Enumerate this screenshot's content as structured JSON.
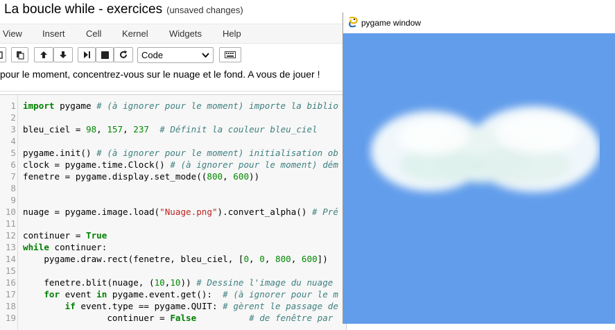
{
  "notebook": {
    "title": "La boucle while - exercices",
    "unsaved": "(unsaved changes)",
    "menu": [
      "View",
      "Insert",
      "Cell",
      "Kernel",
      "Widgets",
      "Help"
    ],
    "cell_type": "Code",
    "markdown_line": "pour le moment, concentrez-vous sur le nuage et le fond. A vous de jouer !"
  },
  "code": {
    "line_numbers": [
      "1",
      "2",
      "3",
      "4",
      "5",
      "6",
      "7",
      "8",
      "9",
      "10",
      "11",
      "12",
      "13",
      "14",
      "15",
      "16",
      "17",
      "18",
      "19"
    ]
  },
  "pygame_window": {
    "title": "pygame window",
    "background": "#629deb"
  },
  "colors": {
    "keyword": "#008000",
    "comment": "#408080",
    "number": "#008800",
    "string": "#ba2121"
  }
}
